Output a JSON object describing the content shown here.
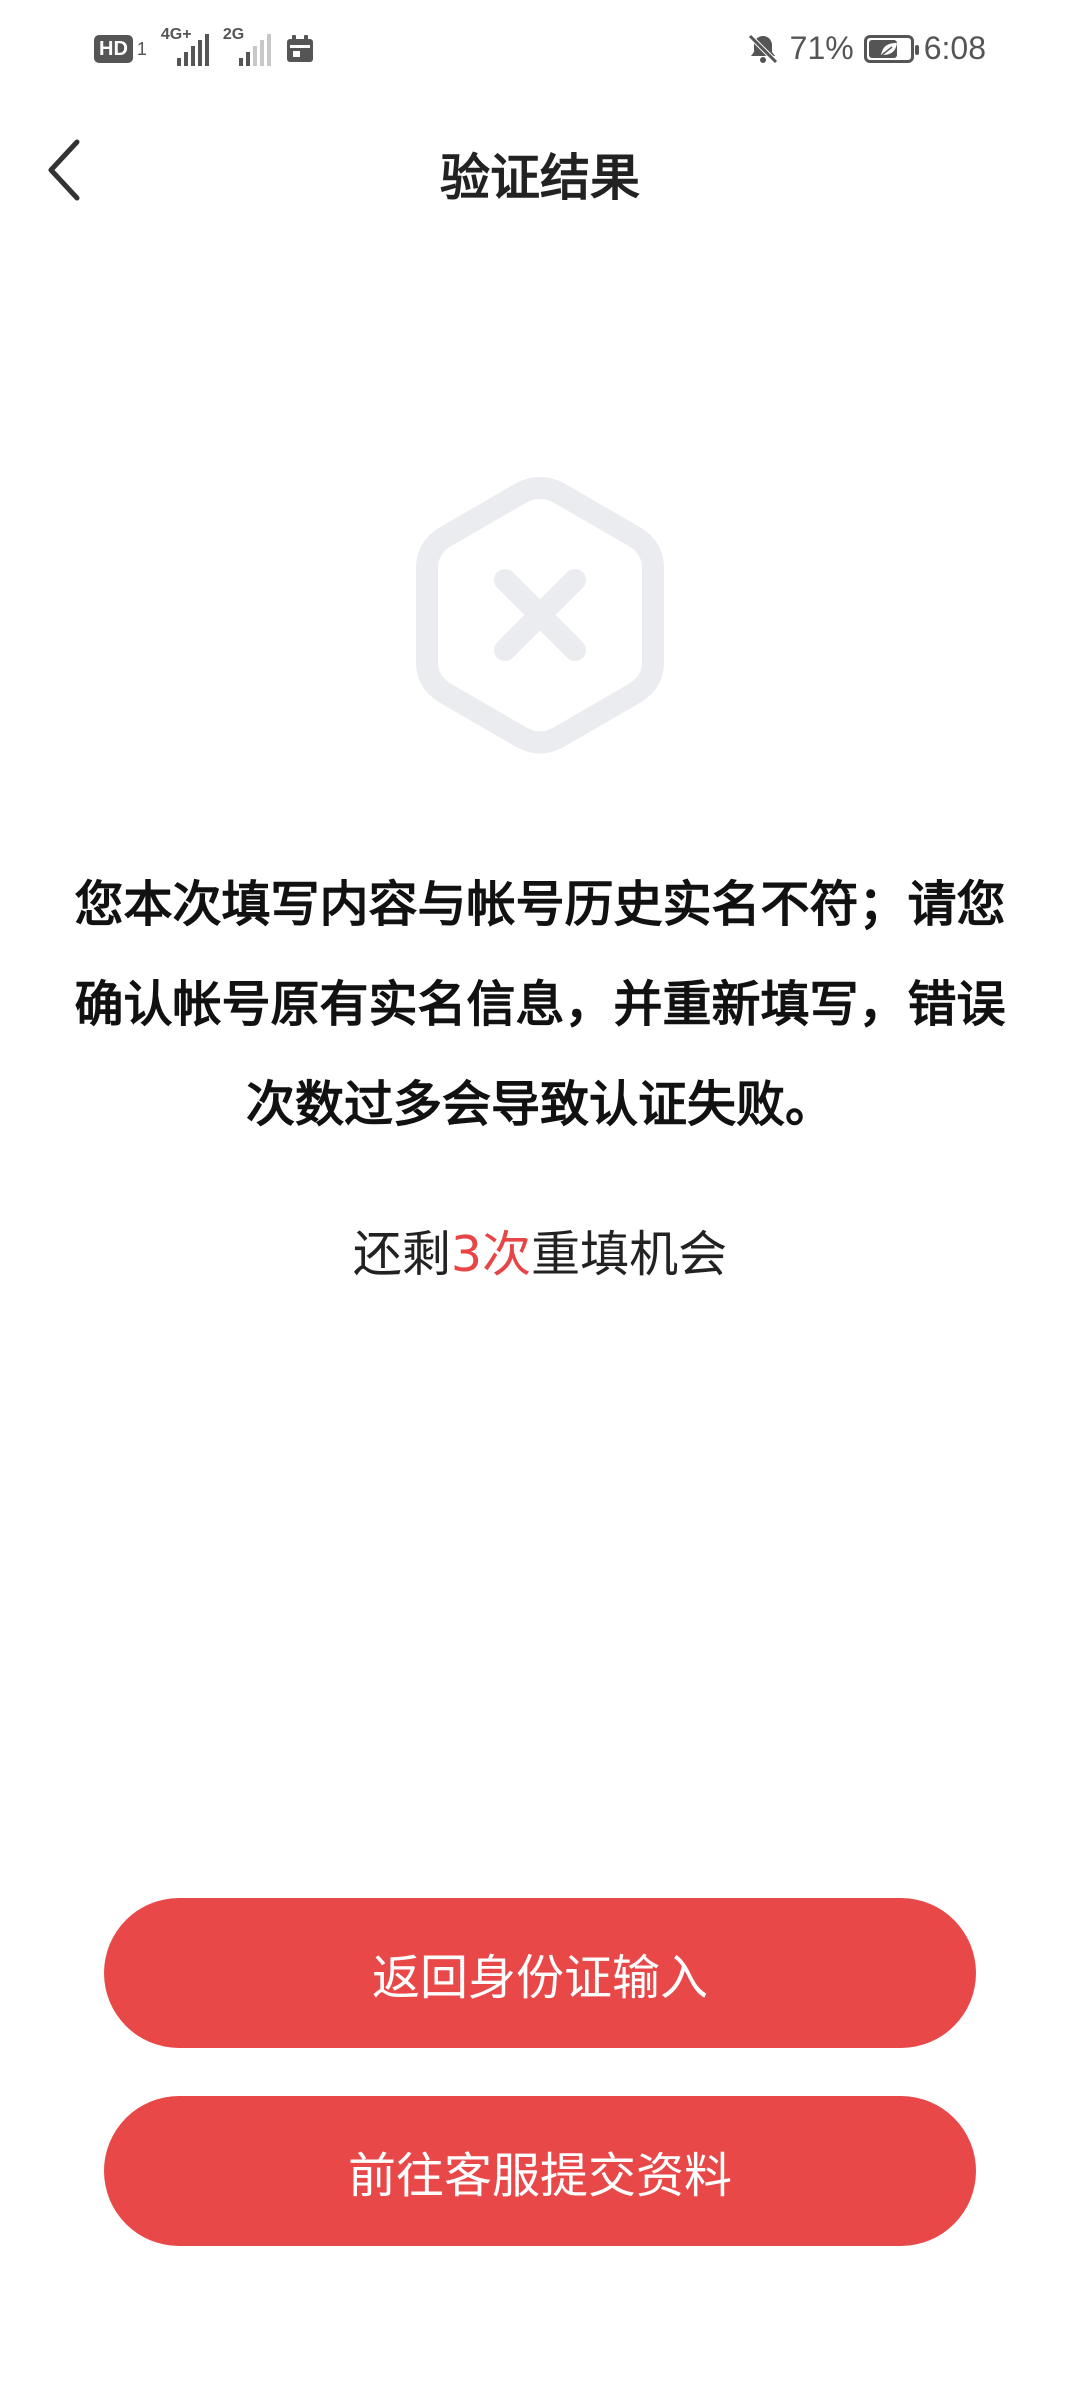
{
  "status_bar": {
    "hd_label": "HD",
    "sim1_number": "1",
    "network1": "4G+",
    "network2": "2G",
    "battery_percent": "71%",
    "battery_level": 0.71,
    "time": "6:08"
  },
  "header": {
    "title": "验证结果"
  },
  "result": {
    "message": "您本次填写内容与帐号历史实名不符；请您确认帐号原有实名信息，并重新填写，错误次数过多会导致认证失败。",
    "remaining_prefix": "还剩",
    "remaining_count": "3次",
    "remaining_suffix": "重填机会"
  },
  "actions": {
    "return_label": "返回身份证输入",
    "service_label": "前往客服提交资料"
  },
  "colors": {
    "accent": "#e94848",
    "icon_gray": "#ebecef"
  }
}
